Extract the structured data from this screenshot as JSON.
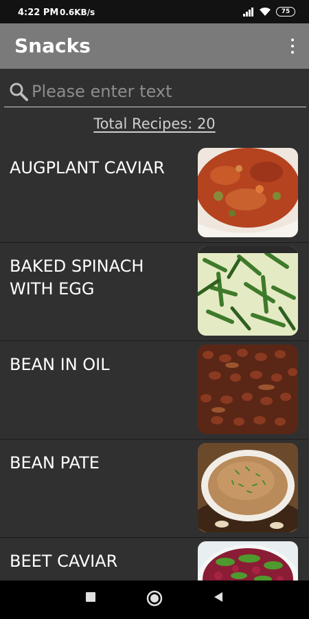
{
  "status": {
    "time": "4:22 PM",
    "speed": "0.6KB/s",
    "battery": "75",
    "icons": [
      "signal-icon",
      "wifi-icon",
      "battery-icon"
    ]
  },
  "appbar": {
    "title": "Snacks",
    "menu_icon": "more-vert-icon"
  },
  "search": {
    "placeholder": "Please enter text",
    "value": "",
    "icon": "search-icon"
  },
  "total": "Total Recipes: 20",
  "recipes": [
    {
      "name": "AUGPLANT CAVIAR"
    },
    {
      "name": "BAKED SPINACH WITH EGG"
    },
    {
      "name": "BEAN IN OIL"
    },
    {
      "name": "BEAN PATE"
    },
    {
      "name": "BEET CAVIAR"
    }
  ],
  "nav": {
    "icons": [
      "recents-square-icon",
      "home-circle-icon",
      "back-triangle-icon"
    ]
  },
  "colors": {
    "appbar": "#7a7a7a",
    "background": "#303030",
    "statusbar": "#121212",
    "navbar": "#000000"
  }
}
